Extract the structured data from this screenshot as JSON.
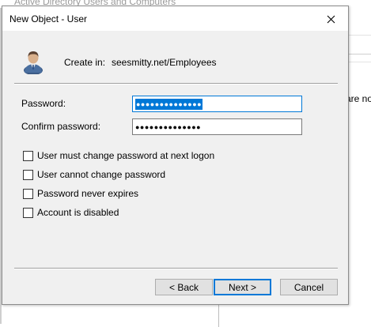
{
  "background_window": {
    "title": "Active Directory Users and Computers",
    "side_text": "are no"
  },
  "dialog": {
    "title": "New Object - User",
    "close_glyph": "✕",
    "create_in_label": "Create in:",
    "create_in_path": "seesmitty.net/Employees",
    "fields": {
      "password_label": "Password:",
      "password_mask": "●●●●●●●●●●●●●●",
      "confirm_label": "Confirm password:",
      "confirm_mask": "●●●●●●●●●●●●●●"
    },
    "options": [
      {
        "label": "User must change password at next logon",
        "checked": false
      },
      {
        "label": "User cannot change password",
        "checked": false
      },
      {
        "label": "Password never expires",
        "checked": false
      },
      {
        "label": "Account is disabled",
        "checked": false
      }
    ],
    "buttons": {
      "back": "< Back",
      "next": "Next >",
      "cancel": "Cancel"
    },
    "icons": {
      "user": "user-icon",
      "close": "close-icon"
    },
    "colors": {
      "selection": "#0078d7",
      "focus_border": "#0078d7"
    }
  }
}
